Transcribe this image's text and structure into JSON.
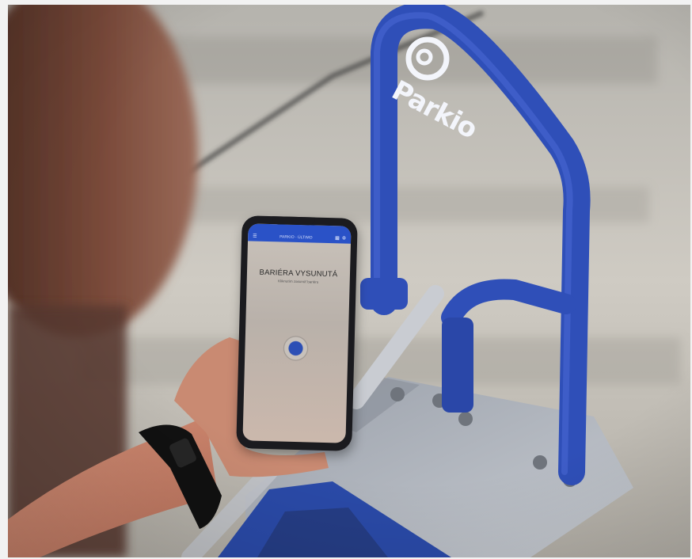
{
  "photo": {
    "brand_name": "Parkio",
    "phone_screen": {
      "app_bar_title": "PARKIO · ÚLTIMO",
      "message_title": "BARIÉRA VYSUNUTÁ",
      "message_subtitle": "Kliknutím zasunúť bariéru",
      "menu_icon": "menu-icon",
      "settings_icon": "settings-icon"
    },
    "colors": {
      "barrier_blue": "#2f4fb8",
      "phone_body": "#1b1b1f",
      "app_bar": "#2a52c7"
    }
  }
}
